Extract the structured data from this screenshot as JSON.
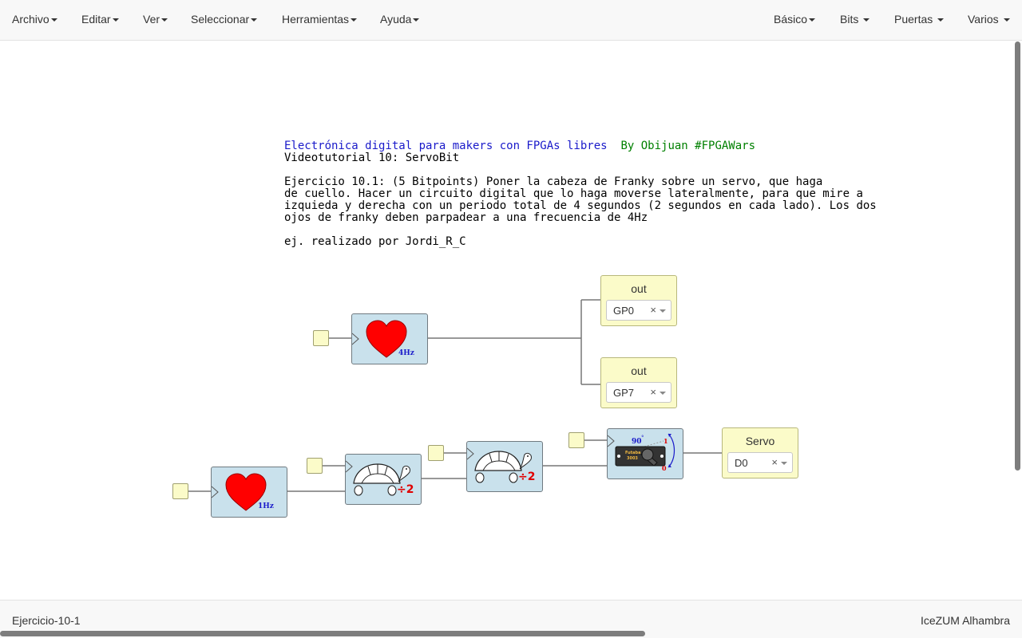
{
  "menubar": {
    "left": [
      "Archivo",
      "Editar",
      "Ver",
      "Seleccionar",
      "Herramientas",
      "Ayuda"
    ],
    "right": [
      "Básico",
      "Bits",
      "Puertas",
      "Varios"
    ]
  },
  "info": {
    "line1_blue": "Electrónica digital para makers con FPGAs libres",
    "line1_green": "By Obijuan #FPGAWars",
    "line2": "Videotutorial 10: ServoBit",
    "ex_title": "Ejercicio 10.1",
    "ex_line1": ": (5 Bitpoints) Poner la cabeza de Franky sobre un servo, que haga",
    "ex_line2": "de cuello. Hacer un circuito digital que lo haga moverse lateralmente, para que mire a",
    "ex_line3": "izquieda y derecha con un periodo total de 4 segundos (2 segundos en cada lado). Los dos",
    "ex_line4": "ojos de franky deben parpadear a una frecuencia de 4Hz",
    "author_prefix": "ej. realizado por ",
    "author_name": "Jordi_R_C"
  },
  "blocks": {
    "heart_top_label": "4Hz",
    "heart_bottom_label": "1Hz",
    "div_label": "÷2",
    "servo_angle": "90",
    "servo_deg": "°",
    "servo_hi": "1",
    "servo_lo": "0",
    "servo_brand": "Futaba",
    "servo_model": "3003"
  },
  "io": {
    "out1": {
      "title": "out",
      "value": "GP0",
      "clear": "×"
    },
    "out2": {
      "title": "out",
      "value": "GP7",
      "clear": "×"
    },
    "servo": {
      "title": "Servo",
      "value": "D0",
      "clear": "×"
    }
  },
  "status": {
    "filename": "Ejercicio-10-1",
    "board": "IceZUM Alhambra"
  },
  "colors": {
    "block_bg": "#c9e1ec",
    "io_bg": "#fbfbc9",
    "heart": "#ff0000",
    "info_blue": "#1a1aca",
    "info_green": "#008000"
  }
}
